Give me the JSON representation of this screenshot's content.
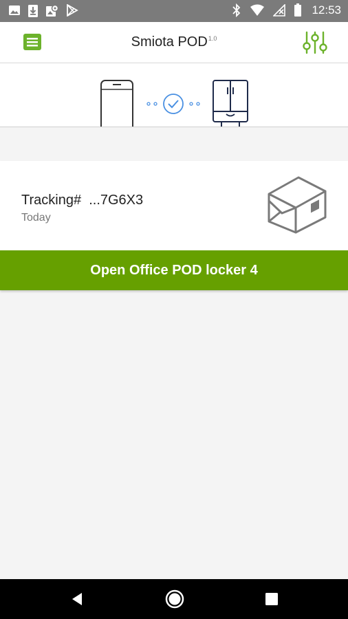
{
  "status_bar": {
    "time": "12:53",
    "left_icons": [
      "image-icon",
      "download-icon",
      "map-icon",
      "play-store-icon"
    ],
    "right_icons": [
      "bluetooth-icon",
      "wifi-icon",
      "no-signal-icon",
      "battery-icon"
    ]
  },
  "app_bar": {
    "title": "Smiota POD",
    "version": "1.0",
    "menu_icon": "menu-icon",
    "settings_icon": "sliders-icon"
  },
  "connection": {
    "phone_icon": "phone-icon",
    "status_icon": "check-circle-icon",
    "locker_icon": "locker-icon"
  },
  "package": {
    "tracking_label": "Tracking#",
    "tracking_number": "...7G6X3",
    "date": "Today",
    "icon": "package-icon"
  },
  "action": {
    "open_label": "Open Office POD locker 4"
  },
  "colors": {
    "accent_green": "#66a000",
    "icon_green": "#6cb22b",
    "link_blue": "#4a90e2",
    "status_bar": "#7b7b7b"
  },
  "nav_bar": {
    "icons": [
      "back-icon",
      "home-icon",
      "recents-icon"
    ]
  }
}
